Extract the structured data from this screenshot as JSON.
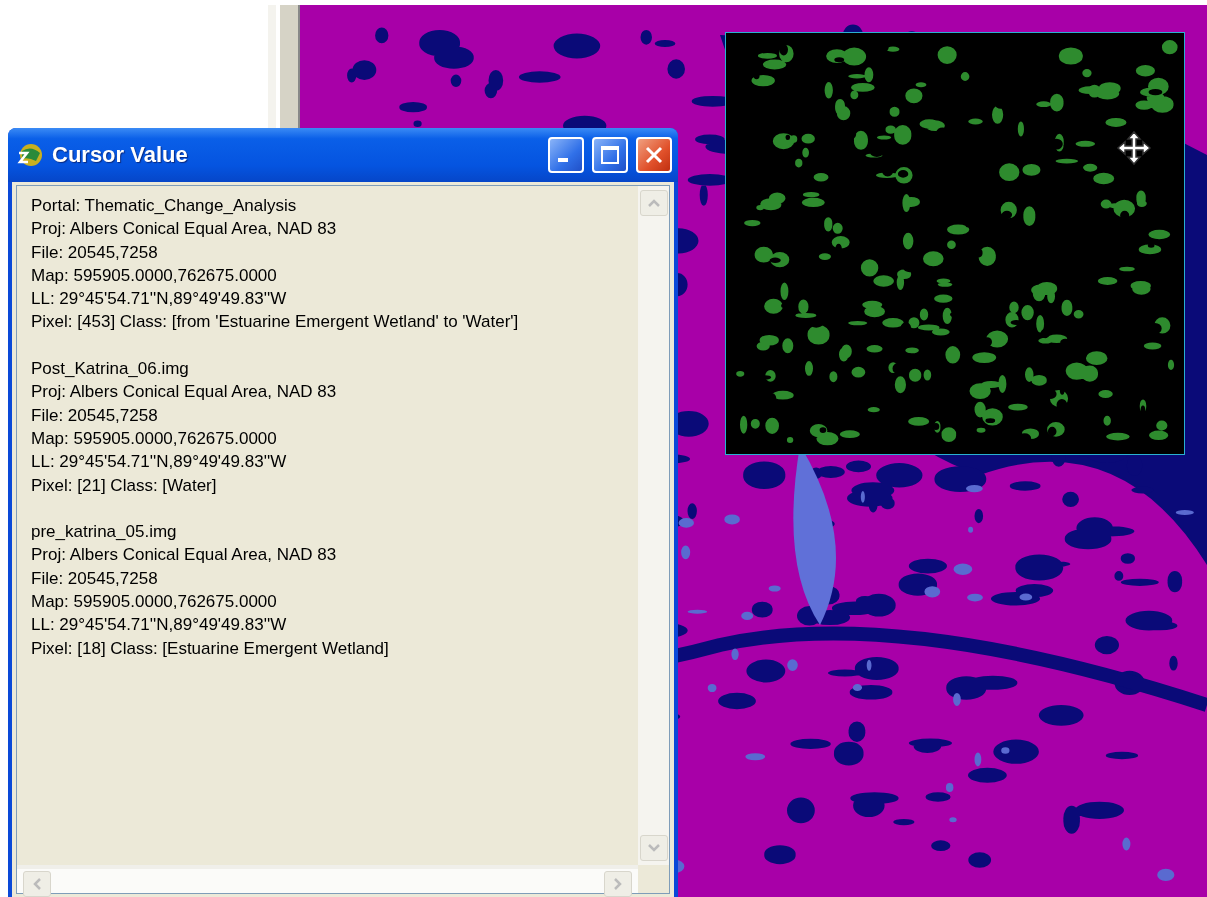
{
  "window": {
    "title": "Cursor Value"
  },
  "text_blocks": [
    {
      "lines": [
        "Portal: Thematic_Change_Analysis",
        "Proj: Albers Conical Equal Area, NAD 83",
        "File: 20545,7258",
        "Map: 595905.0000,762675.0000",
        "LL: 29°45'54.71''N,89°49'49.83''W",
        "Pixel: [453] Class: [from 'Estuarine Emergent Wetland' to 'Water']"
      ]
    },
    {
      "lines": [
        "Post_Katrina_06.img",
        "Proj: Albers Conical Equal Area, NAD 83",
        "File: 20545,7258",
        "Map: 595905.0000,762675.0000",
        "LL: 29°45'54.71''N,89°49'49.83''W",
        "Pixel: [21] Class: [Water]"
      ]
    },
    {
      "lines": [
        "pre_katrina_05.img",
        "Proj: Albers Conical Equal Area, NAD 83",
        "File: 20545,7258",
        "Map: 595905.0000,762675.0000",
        "LL: 29°45'54.71''N,89°49'49.83''W",
        "Pixel: [18] Class: [Estuarine Emergent Wetland]"
      ]
    }
  ]
}
